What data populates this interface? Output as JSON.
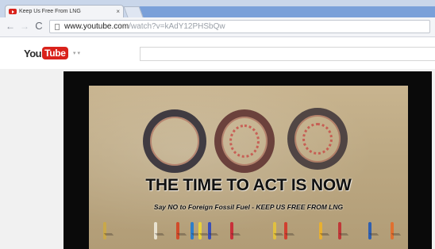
{
  "browser": {
    "tab": {
      "title": "Keep Us Free From LNG",
      "close_glyph": "×",
      "favicon": "youtube-favicon-icon"
    },
    "nav": {
      "back_glyph": "←",
      "forward_glyph": "→",
      "reload_glyph": "C"
    },
    "address": {
      "host": "www.youtube.com",
      "path": "/watch?v=kAdY12PHSbQw"
    }
  },
  "youtube": {
    "logo_you": "You",
    "logo_tube": "Tube",
    "menu_glyph": "▾ ▾",
    "brand_color": "#d9221b"
  },
  "video": {
    "headline": "THE TIME TO ACT IS NOW",
    "subline": "Say NO to Foreign Fossil Fuel - KEEP US FREE FROM LNG",
    "figure_colors": [
      "#c9a84a",
      "#e8e2d0",
      "#d14b2a",
      "#2d7ec9",
      "#e9d23a",
      "#3a4fb8",
      "#c8303a",
      "#e0c040",
      "#d04030",
      "#e8b030",
      "#c03838",
      "#3060b0",
      "#e07030"
    ]
  }
}
